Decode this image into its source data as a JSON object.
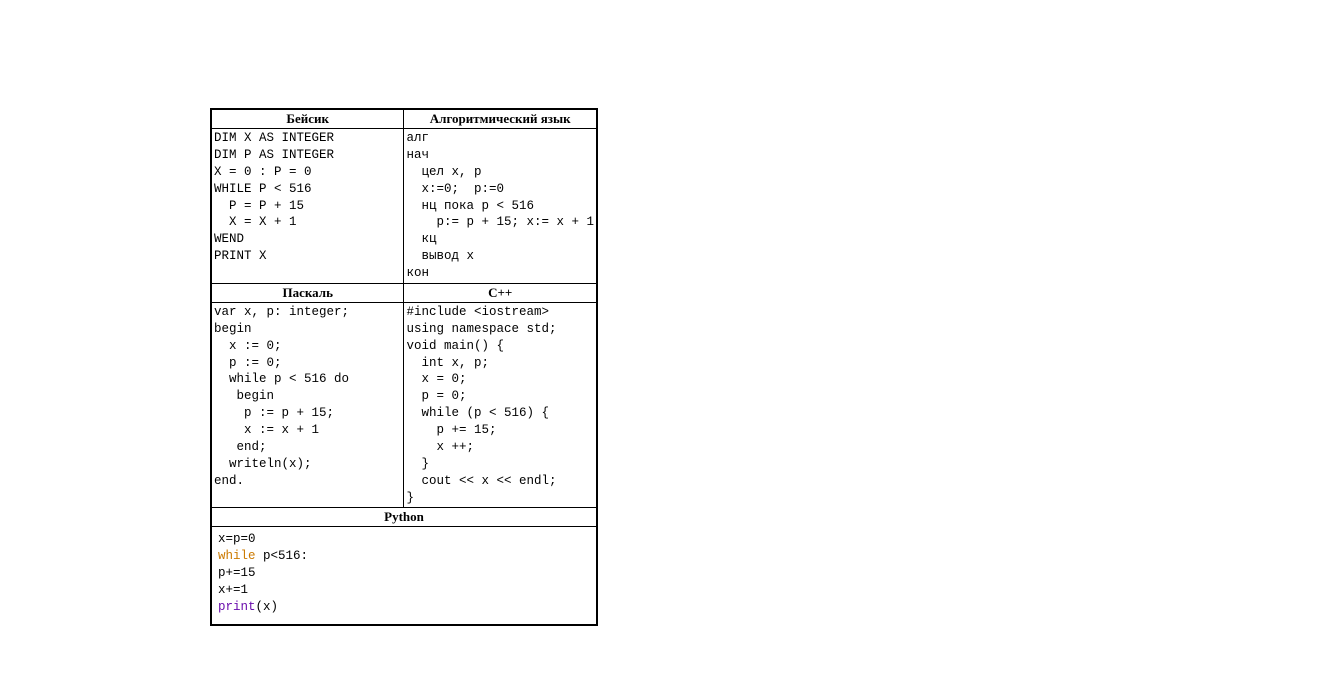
{
  "headers": {
    "basic": "Бейсик",
    "algo": "Алгоритмический язык",
    "pascal": "Паскаль",
    "cpp": "С++",
    "python": "Python"
  },
  "code": {
    "basic": "DIM X AS INTEGER\nDIM P AS INTEGER\nX = 0 : P = 0\nWHILE P < 516\n  P = P + 15\n  X = X + 1\nWEND\nPRINT X\n",
    "algo": "алг\nнач\n  цел x, p\n  x:=0;  p:=0\n  нц пока p < 516\n    p:= p + 15; x:= x + 1\n  кц\n  вывод x\nкон",
    "pascal": "var x, p: integer;\nbegin\n  x := 0;\n  p := 0;\n  while p < 516 do\n   begin\n    p := p + 15;\n    x := x + 1\n   end;\n  writeln(x);\nend.",
    "cpp": "#include <iostream>\nusing namespace std;\nvoid main() {\n  int x, p;\n  x = 0;\n  p = 0;\n  while (p < 516) {\n    p += 15;\n    x ++;\n  }\n  cout << x << endl;\n}"
  },
  "python": {
    "l1": "x=p=0",
    "kw_while": "while",
    "l2_rest": " p<516:",
    "l3": "    p+=15",
    "l4": "    x+=1",
    "fn_print": "print",
    "l5_rest": "(x)"
  }
}
